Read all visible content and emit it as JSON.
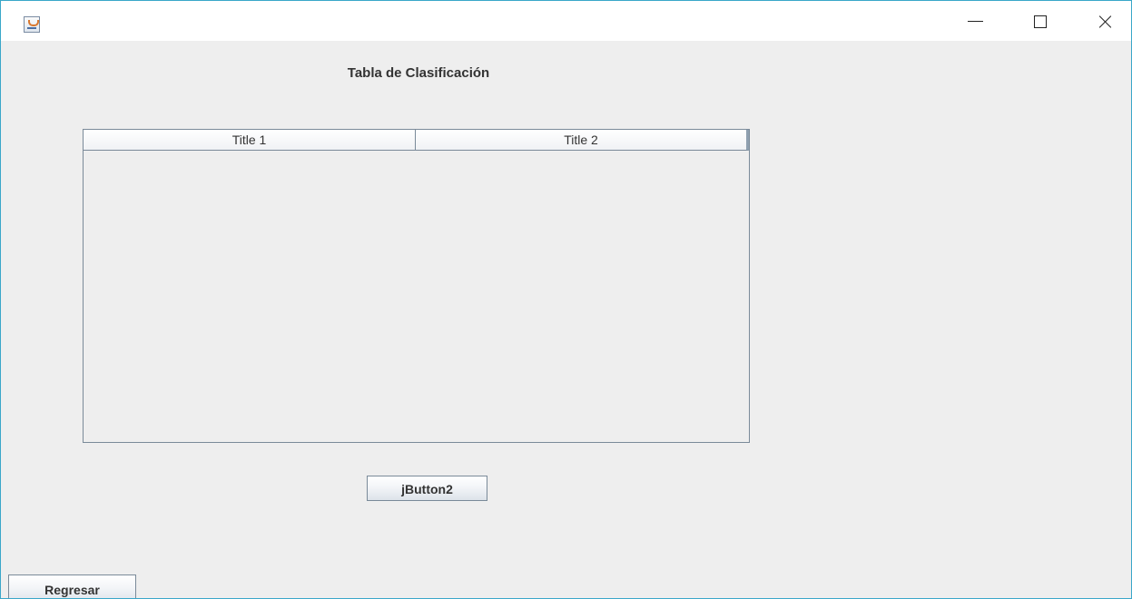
{
  "window": {
    "title": "",
    "controls": {
      "minimize": "minimize-icon",
      "maximize": "maximize-icon",
      "close": "close-icon"
    }
  },
  "content": {
    "heading": "Tabla de Clasificación",
    "table": {
      "columns": [
        "Title 1",
        "Title 2"
      ],
      "rows": []
    },
    "action_button_label": "jButton2",
    "back_button_label": "Regresar"
  },
  "colors": {
    "background": "#eeeeee",
    "window_border": "#3aa7c9",
    "table_border": "#7a8a99"
  }
}
